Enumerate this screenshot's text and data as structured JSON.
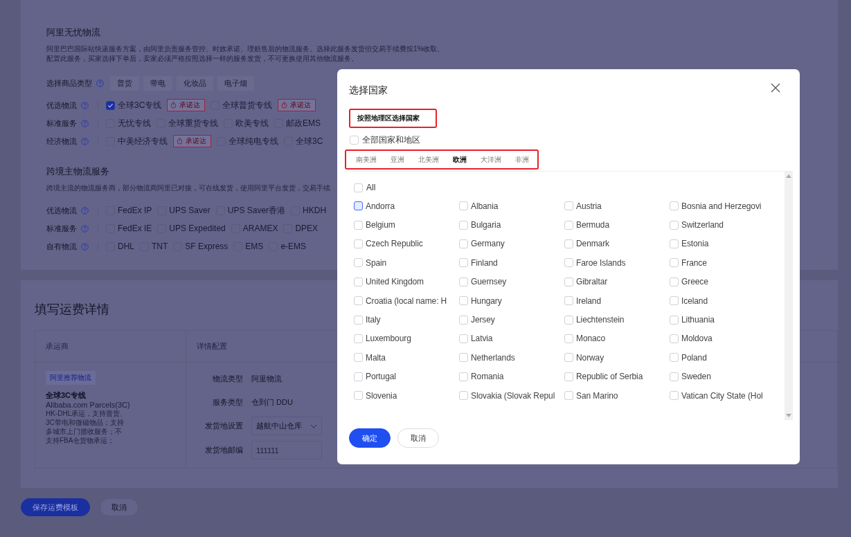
{
  "shipping_section": {
    "title": "阿里无忧物流",
    "description": [
      "阿里巴巴国际站快递服务方案，由阿里负责服务管控、时效承诺、理赔售后的物流服务。选择此服务发货但交易手续费按1%收取。",
      "配置此服务，买家选择下单后，卖家必须严格按照选择一样的服务发货，不可更换使用其他物流服务。"
    ],
    "category_row": {
      "label": "选择商品类型",
      "options": [
        "普货",
        "带电",
        "化妆品",
        "电子烟"
      ]
    },
    "rows": [
      {
        "label": "优选物流",
        "items": [
          {
            "kind": "option",
            "label": "全球3C专线",
            "checked": true
          },
          {
            "kind": "badge",
            "label": "承诺达"
          },
          {
            "kind": "option",
            "label": "全球普货专线",
            "checked": false
          },
          {
            "kind": "badge",
            "label": "承诺达"
          }
        ]
      },
      {
        "label": "标准服务",
        "items": [
          {
            "kind": "option",
            "label": "无忧专线",
            "checked": false
          },
          {
            "kind": "option",
            "label": "全球重货专线",
            "checked": false
          },
          {
            "kind": "option",
            "label": "欧美专线",
            "checked": false
          },
          {
            "kind": "option",
            "label": "邮政EMS",
            "checked": false
          }
        ]
      },
      {
        "label": "经济物流",
        "items": [
          {
            "kind": "option",
            "label": "中美经济专线",
            "checked": false
          },
          {
            "kind": "badge",
            "label": "承诺达"
          },
          {
            "kind": "option",
            "label": "全球纯电专线",
            "checked": false
          },
          {
            "kind": "option",
            "label": "全球3C",
            "checked": false
          }
        ]
      }
    ]
  },
  "carrier_section": {
    "title": "跨境主物流服务",
    "description": "跨境主流的物流服务商，部分物流商阿里已对接，可在线发货，使用阿里平台发货，交易手续",
    "rows": [
      {
        "label": "优选物流",
        "items": [
          {
            "kind": "option",
            "label": "FedEx IP",
            "checked": false
          },
          {
            "kind": "option",
            "label": "UPS Saver",
            "checked": false
          },
          {
            "kind": "option",
            "label": "UPS Saver香港",
            "checked": false
          },
          {
            "kind": "option",
            "label": "HKDH",
            "checked": false
          }
        ]
      },
      {
        "label": "标准服务",
        "items": [
          {
            "kind": "option",
            "label": "FedEx IE",
            "checked": false
          },
          {
            "kind": "option",
            "label": "UPS Expedited",
            "checked": false
          },
          {
            "kind": "option",
            "label": "ARAMEX",
            "checked": false
          },
          {
            "kind": "option",
            "label": "DPEX",
            "checked": false
          }
        ]
      },
      {
        "label": "自有物流",
        "items": [
          {
            "kind": "option",
            "label": "DHL",
            "checked": false
          },
          {
            "kind": "option",
            "label": "TNT",
            "checked": false
          },
          {
            "kind": "option",
            "label": "SF Express",
            "checked": false
          },
          {
            "kind": "option",
            "label": "EMS",
            "checked": false
          },
          {
            "kind": "option",
            "label": "e-EMS",
            "checked": false
          }
        ]
      }
    ]
  },
  "freight_details": {
    "title": "填写运费详情",
    "columns": [
      "承运商",
      "详情配置"
    ],
    "carrier": {
      "tag": "阿里推荐物流",
      "name": "全球3C专线",
      "service": "Alibaba.com Parcels(3C)",
      "note": "HK-DHL承运，支持普货、3C带电和微磁物品；支持多城市上门揽收服务；不支持FBA仓货物承运；"
    },
    "fields": [
      {
        "kind": "text",
        "label": "物流类型",
        "value": "阿里物流"
      },
      {
        "kind": "text",
        "label": "服务类型",
        "value": "仓到门 DDU"
      },
      {
        "kind": "select",
        "label": "发货地设置",
        "value": "越航中山仓库"
      },
      {
        "kind": "input",
        "label": "发货地邮编",
        "value": "111111"
      }
    ]
  },
  "page_buttons": [
    {
      "kind": "primary",
      "label": "保存运费模板"
    },
    {
      "kind": "secondary",
      "label": "取消"
    }
  ],
  "dialog": {
    "title": "选择国家",
    "section_label": "按照地理区选择国家",
    "all_regions": {
      "label": "全部国家和地区",
      "checked": false
    },
    "tabs": [
      {
        "label": "南美洲",
        "selected": false
      },
      {
        "label": "亚洲",
        "selected": false
      },
      {
        "label": "北美洲",
        "selected": false
      },
      {
        "label": "欧洲",
        "selected": true
      },
      {
        "label": "大洋洲",
        "selected": false
      },
      {
        "label": "非洲",
        "selected": false
      }
    ],
    "select_all": {
      "label": "All",
      "checked": false
    },
    "countries": [
      {
        "name": "Andorra",
        "checked": false,
        "hovered": true
      },
      {
        "name": "Albania",
        "checked": false,
        "hovered": false
      },
      {
        "name": "Austria",
        "checked": false,
        "hovered": false
      },
      {
        "name": "Bosnia and Herzegovi",
        "checked": false,
        "hovered": false
      },
      {
        "name": "Belgium",
        "checked": false,
        "hovered": false
      },
      {
        "name": "Bulgaria",
        "checked": false,
        "hovered": false
      },
      {
        "name": "Bermuda",
        "checked": false,
        "hovered": false
      },
      {
        "name": "Switzerland",
        "checked": false,
        "hovered": false
      },
      {
        "name": "Czech Republic",
        "checked": false,
        "hovered": false
      },
      {
        "name": "Germany",
        "checked": false,
        "hovered": false
      },
      {
        "name": "Denmark",
        "checked": false,
        "hovered": false
      },
      {
        "name": "Estonia",
        "checked": false,
        "hovered": false
      },
      {
        "name": "Spain",
        "checked": false,
        "hovered": false
      },
      {
        "name": "Finland",
        "checked": false,
        "hovered": false
      },
      {
        "name": "Faroe Islands",
        "checked": false,
        "hovered": false
      },
      {
        "name": "France",
        "checked": false,
        "hovered": false
      },
      {
        "name": "United Kingdom",
        "checked": false,
        "hovered": false
      },
      {
        "name": "Guernsey",
        "checked": false,
        "hovered": false
      },
      {
        "name": "Gibraltar",
        "checked": false,
        "hovered": false
      },
      {
        "name": "Greece",
        "checked": false,
        "hovered": false
      },
      {
        "name": "Croatia (local name: H",
        "checked": false,
        "hovered": false
      },
      {
        "name": "Hungary",
        "checked": false,
        "hovered": false
      },
      {
        "name": "Ireland",
        "checked": false,
        "hovered": false
      },
      {
        "name": "Iceland",
        "checked": false,
        "hovered": false
      },
      {
        "name": "Italy",
        "checked": false,
        "hovered": false
      },
      {
        "name": "Jersey",
        "checked": false,
        "hovered": false
      },
      {
        "name": "Liechtenstein",
        "checked": false,
        "hovered": false
      },
      {
        "name": "Lithuania",
        "checked": false,
        "hovered": false
      },
      {
        "name": "Luxembourg",
        "checked": false,
        "hovered": false
      },
      {
        "name": "Latvia",
        "checked": false,
        "hovered": false
      },
      {
        "name": "Monaco",
        "checked": false,
        "hovered": false
      },
      {
        "name": "Moldova",
        "checked": false,
        "hovered": false
      },
      {
        "name": "Malta",
        "checked": false,
        "hovered": false
      },
      {
        "name": "Netherlands",
        "checked": false,
        "hovered": false
      },
      {
        "name": "Norway",
        "checked": false,
        "hovered": false
      },
      {
        "name": "Poland",
        "checked": false,
        "hovered": false
      },
      {
        "name": "Portugal",
        "checked": false,
        "hovered": false
      },
      {
        "name": "Romania",
        "checked": false,
        "hovered": false
      },
      {
        "name": "Republic of Serbia",
        "checked": false,
        "hovered": false
      },
      {
        "name": "Sweden",
        "checked": false,
        "hovered": false
      },
      {
        "name": "Slovenia",
        "checked": false,
        "hovered": false
      },
      {
        "name": "Slovakia (Slovak Repul",
        "checked": false,
        "hovered": false
      },
      {
        "name": "San Marino",
        "checked": false,
        "hovered": false
      },
      {
        "name": "Vatican City State (Hol",
        "checked": false,
        "hovered": false
      }
    ],
    "buttons": [
      {
        "kind": "primary",
        "label": "确定"
      },
      {
        "kind": "secondary",
        "label": "取消"
      }
    ]
  }
}
